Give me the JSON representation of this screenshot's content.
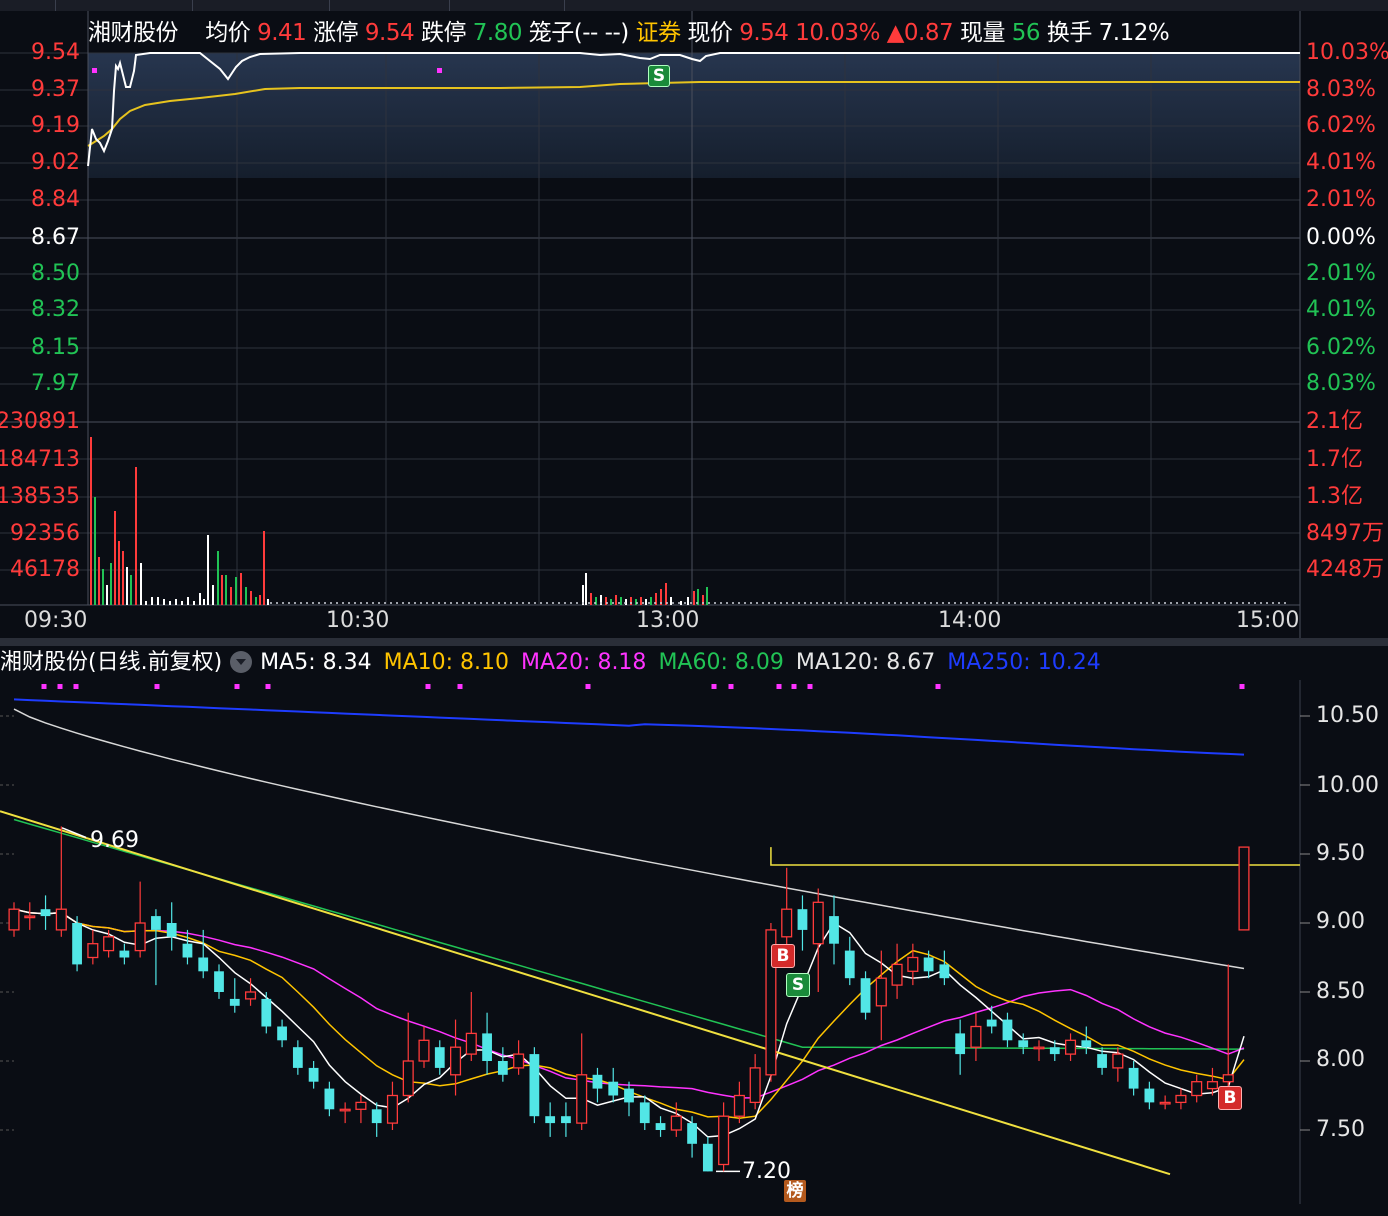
{
  "header": {
    "name": "湘财股份",
    "avg_label": "均价",
    "avg_value": "9.41",
    "limit_up_label": "涨停",
    "limit_up_value": "9.54",
    "limit_down_label": "跌停",
    "limit_down_value": "7.80",
    "cage_label": "笼子(-- --)",
    "sector": "证券",
    "price_label": "现价",
    "price_value": "9.54",
    "change_pct": "10.03%",
    "change_abs": "▲0.87",
    "vol_label": "现量",
    "vol_value": "56",
    "turnover_label": "换手",
    "turnover_value": "7.12%"
  },
  "intraday_chart": {
    "type": "line",
    "price_axis_left": [
      "9.54",
      "9.37",
      "9.19",
      "9.02",
      "8.84",
      "8.67",
      "8.50",
      "8.32",
      "8.15",
      "7.97"
    ],
    "pct_axis_right": [
      "10.03%",
      "8.03%",
      "6.02%",
      "4.01%",
      "2.01%",
      "0.00%",
      "2.01%",
      "4.01%",
      "6.02%",
      "8.03%"
    ],
    "volume_axis_left": [
      "230891",
      "184713",
      "138535",
      "92356",
      "46178"
    ],
    "volume_axis_right": [
      "2.1亿",
      "1.7亿",
      "1.3亿",
      "8497万",
      "4248万"
    ],
    "time_labels": [
      "09:30",
      "10:30",
      "13:00",
      "14:00",
      "15:00"
    ],
    "price_ylim": [
      7.8,
      9.54
    ],
    "prev_close": 8.67,
    "sell_marker": "S",
    "colors": {
      "price_line": "#ffffff",
      "avg_line": "#e6c31e",
      "up": "#ff3b3b",
      "down": "#21c355"
    }
  },
  "kline": {
    "title": "湘财股份(日线.前复权)",
    "ma": [
      {
        "label": "MA5: 8.34",
        "color": "#ffffff"
      },
      {
        "label": "MA10: 8.10",
        "color": "#ffc400"
      },
      {
        "label": "MA20: 8.18",
        "color": "#ff33ff"
      },
      {
        "label": "MA60: 8.09",
        "color": "#21c355"
      },
      {
        "label": "MA120: 8.67",
        "color": "#e6e6e6"
      },
      {
        "label": "MA250: 10.24",
        "color": "#1e3cff"
      }
    ],
    "price_axis": [
      "10.50",
      "10.00",
      "9.50",
      "9.00",
      "8.50",
      "8.00",
      "7.50"
    ],
    "ylim": [
      7.2,
      10.7
    ],
    "high_annotation": "9.69",
    "low_annotation": "7.20",
    "buy_marker": "B",
    "sell_marker": "S",
    "rank_marker": "榜"
  },
  "chart_data": [
    {
      "type": "line",
      "title": "湘财股份 intraday",
      "x": [
        "09:30",
        "10:30",
        "13:00",
        "14:00",
        "15:00"
      ],
      "series": [],
      "ylim": [
        7.8,
        9.54
      ]
    },
    {
      "type": "bar",
      "title": "湘财股份(日线.前复权)",
      "series": [
        {
          "name": "MA5",
          "values": [
            8.34
          ]
        },
        {
          "name": "MA10",
          "values": [
            8.1
          ]
        },
        {
          "name": "MA20",
          "values": [
            8.18
          ]
        },
        {
          "name": "MA60",
          "values": [
            8.09
          ]
        },
        {
          "name": "MA120",
          "values": [
            8.67
          ]
        },
        {
          "name": "MA250",
          "values": [
            10.24
          ]
        }
      ],
      "ylim": [
        7.2,
        10.7
      ],
      "candles": [
        [
          8.95,
          9.1,
          9.15,
          8.9
        ],
        [
          9.05,
          9.05,
          9.15,
          8.95
        ],
        [
          9.1,
          9.05,
          9.2,
          8.95
        ],
        [
          8.95,
          9.1,
          9.7,
          8.9
        ],
        [
          9.0,
          8.7,
          9.05,
          8.65
        ],
        [
          8.75,
          8.85,
          8.95,
          8.7
        ],
        [
          8.8,
          8.9,
          8.95,
          8.75
        ],
        [
          8.8,
          8.75,
          8.85,
          8.7
        ],
        [
          8.8,
          9.0,
          9.3,
          8.75
        ],
        [
          9.05,
          8.95,
          9.1,
          8.55
        ],
        [
          9.0,
          8.9,
          9.15,
          8.8
        ],
        [
          8.85,
          8.75,
          8.95,
          8.7
        ],
        [
          8.75,
          8.65,
          8.95,
          8.6
        ],
        [
          8.65,
          8.5,
          8.7,
          8.45
        ],
        [
          8.45,
          8.4,
          8.6,
          8.35
        ],
        [
          8.45,
          8.5,
          8.6,
          8.4
        ],
        [
          8.45,
          8.25,
          8.5,
          8.2
        ],
        [
          8.25,
          8.15,
          8.3,
          8.1
        ],
        [
          8.1,
          7.95,
          8.15,
          7.9
        ],
        [
          7.95,
          7.85,
          8.0,
          7.8
        ],
        [
          7.8,
          7.65,
          7.85,
          7.6
        ],
        [
          7.65,
          7.65,
          7.7,
          7.55
        ],
        [
          7.65,
          7.7,
          7.75,
          7.55
        ],
        [
          7.65,
          7.55,
          7.7,
          7.45
        ],
        [
          7.55,
          7.75,
          7.85,
          7.5
        ],
        [
          7.75,
          8.0,
          8.35,
          7.7
        ],
        [
          8.0,
          8.15,
          8.25,
          7.95
        ],
        [
          8.1,
          7.95,
          8.15,
          7.9
        ],
        [
          7.9,
          8.1,
          8.3,
          7.75
        ],
        [
          8.05,
          8.2,
          8.5,
          8.0
        ],
        [
          8.2,
          8.0,
          8.35,
          7.9
        ],
        [
          8.0,
          7.9,
          8.1,
          7.85
        ],
        [
          7.95,
          8.05,
          8.15,
          7.9
        ],
        [
          8.05,
          7.6,
          8.1,
          7.55
        ],
        [
          7.6,
          7.55,
          7.7,
          7.45
        ],
        [
          7.6,
          7.55,
          7.7,
          7.45
        ],
        [
          7.55,
          7.9,
          8.2,
          7.5
        ],
        [
          7.9,
          7.8,
          7.95,
          7.7
        ],
        [
          7.85,
          7.75,
          7.95,
          7.7
        ],
        [
          7.8,
          7.7,
          7.85,
          7.6
        ],
        [
          7.7,
          7.55,
          7.75,
          7.5
        ],
        [
          7.55,
          7.5,
          7.6,
          7.45
        ],
        [
          7.5,
          7.6,
          7.7,
          7.45
        ],
        [
          7.55,
          7.4,
          7.6,
          7.3
        ],
        [
          7.4,
          7.2,
          7.45,
          7.2
        ],
        [
          7.25,
          7.6,
          7.7,
          7.2
        ],
        [
          7.6,
          7.75,
          7.85,
          7.55
        ],
        [
          7.7,
          7.95,
          8.05,
          7.65
        ],
        [
          7.9,
          8.95,
          9.0,
          7.85
        ],
        [
          8.9,
          9.1,
          9.4,
          8.8
        ],
        [
          9.1,
          8.95,
          9.2,
          8.8
        ],
        [
          8.85,
          9.15,
          9.25,
          8.5
        ],
        [
          9.05,
          8.85,
          9.2,
          8.7
        ],
        [
          8.8,
          8.6,
          8.9,
          8.55
        ],
        [
          8.6,
          8.35,
          8.65,
          8.3
        ],
        [
          8.4,
          8.6,
          8.8,
          8.15
        ],
        [
          8.55,
          8.7,
          8.85,
          8.45
        ],
        [
          8.65,
          8.75,
          8.85,
          8.55
        ],
        [
          8.75,
          8.65,
          8.8,
          8.6
        ],
        [
          8.7,
          8.6,
          8.8,
          8.55
        ],
        [
          8.2,
          8.05,
          8.3,
          7.9
        ],
        [
          8.1,
          8.25,
          8.35,
          8.0
        ],
        [
          8.3,
          8.25,
          8.4,
          8.2
        ],
        [
          8.3,
          8.15,
          8.35,
          8.1
        ],
        [
          8.15,
          8.1,
          8.2,
          8.05
        ],
        [
          8.1,
          8.1,
          8.15,
          8.0
        ],
        [
          8.1,
          8.05,
          8.15,
          8.0
        ],
        [
          8.05,
          8.15,
          8.2,
          8.0
        ],
        [
          8.15,
          8.1,
          8.25,
          8.05
        ],
        [
          8.05,
          7.95,
          8.1,
          7.9
        ],
        [
          7.95,
          8.05,
          8.1,
          7.85
        ],
        [
          7.95,
          7.8,
          8.0,
          7.75
        ],
        [
          7.8,
          7.7,
          7.85,
          7.65
        ],
        [
          7.7,
          7.7,
          7.75,
          7.65
        ],
        [
          7.7,
          7.75,
          7.8,
          7.65
        ],
        [
          7.75,
          7.85,
          7.9,
          7.7
        ],
        [
          7.8,
          7.85,
          7.95,
          7.75
        ],
        [
          7.85,
          7.9,
          8.7,
          7.8
        ],
        [
          8.95,
          9.55,
          9.55,
          8.95
        ]
      ]
    }
  ]
}
